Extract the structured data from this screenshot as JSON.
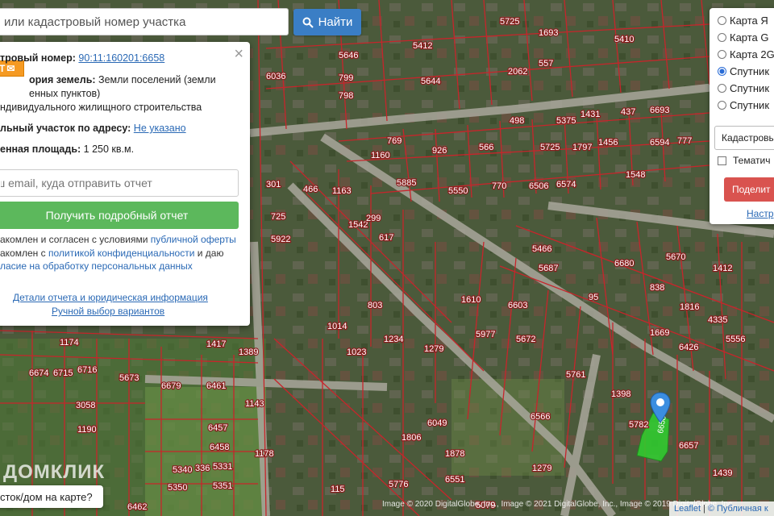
{
  "search": {
    "placeholder": "или кадастровый номер участка",
    "button_label": "Найти"
  },
  "popup": {
    "badge": "T",
    "cadastral_label": "тровый номер:",
    "cadastral_value": "90:11:160201:6658",
    "category_label": "ория земель:",
    "category_value_1": "Земли поселений (земли",
    "category_value_2": "енных пунктов)",
    "use_value": "ндивидуального жилищного строительства",
    "address_label": "льный участок по адресу:",
    "address_value": "Не указано",
    "area_label": "енная площадь:",
    "area_value": "1 250 кв.м.",
    "email_placeholder": "ш email, куда отправить отчет",
    "report_button": "Получить подробный отчет",
    "consent_1a": "акомлен и согласен с условиями ",
    "consent_1b": "публичной оферты",
    "consent_2a": "акомлен с ",
    "consent_2b": "политикой конфиденциальности",
    "consent_2c": " и даю",
    "consent_3": "ласие на обработку персональных данных",
    "details_link": "Детали отчета и юридическая информация",
    "manual_link": "Ручной выбор вариантов"
  },
  "layers": {
    "options": [
      "Карта Я",
      "Карта G",
      "Карта 2G",
      "Спутник",
      "Спутник",
      "Спутник"
    ],
    "selected_index": 3,
    "cadastr_select": "Кадастровые",
    "thematic_label": "Тематич",
    "share_button": "Поделит",
    "settings_link": "Настр"
  },
  "bottom": {
    "question_button": "сток/дом на карте?",
    "logo": "ДОМКЛИК",
    "attribution": "Image © 2020 DigitalGlobe, Inc., Image © 2021 DigitalGlobe, Inc., Image © 2019 DigitalGlobe, Inc.",
    "leaflet": "Leaflet",
    "leaflet_sep": "|",
    "public_map": "Публичная к"
  },
  "map": {
    "parcel_labels": [
      "5646",
      "5412",
      "5725",
      "1693",
      "5410",
      "6036",
      "799",
      "5644",
      "2062",
      "557",
      "798",
      "498",
      "5375",
      "1431",
      "437",
      "6693",
      "769",
      "926",
      "1160",
      "566",
      "5725",
      "1797",
      "1456",
      "6594",
      "777",
      "1548",
      "1163",
      "466",
      "301",
      "5885",
      "5550",
      "770",
      "6506",
      "6574",
      "725",
      "1542",
      "299",
      "617",
      "5922",
      "5466",
      "5687",
      "6680",
      "5670",
      "1412",
      "95",
      "838",
      "1816",
      "1610",
      "6603",
      "5977",
      "5672",
      "803",
      "1014",
      "1023",
      "1234",
      "1279",
      "1174",
      "6679",
      "6674",
      "6715",
      "6716",
      "5673",
      "1417",
      "1389",
      "6461",
      "6426",
      "5556",
      "1669",
      "4335",
      "3058",
      "1190",
      "6457",
      "6458",
      "336",
      "5350",
      "5351",
      "5340",
      "5331",
      "5761",
      "6566",
      "1178",
      "1143",
      "5782",
      "6657",
      "1398",
      "1439",
      "1279",
      "115",
      "6462",
      "1806",
      "6049",
      "5776",
      "6551",
      "1878",
      "5079"
    ],
    "highlighted_parcel": "6658"
  },
  "colors": {
    "accent": "#3a7ec5",
    "report": "#5cb85c",
    "share": "#d9534f",
    "parcel_line": "#c7252b",
    "selected_parcel": "#2fd12f",
    "marker": "#3b8ee0"
  }
}
